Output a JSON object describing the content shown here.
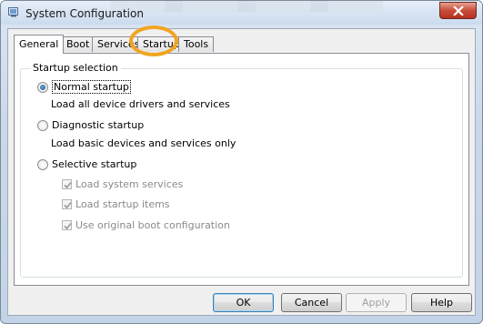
{
  "window": {
    "title": "System Configuration",
    "app_icon": "msconfig-icon",
    "close_icon": "close-icon"
  },
  "tabs": [
    {
      "label": "General",
      "active": true
    },
    {
      "label": "Boot",
      "active": false
    },
    {
      "label": "Services",
      "active": false
    },
    {
      "label": "Startup",
      "active": false
    },
    {
      "label": "Tools",
      "active": false
    }
  ],
  "group": {
    "label": "Startup selection"
  },
  "options": {
    "normal": {
      "label": "Normal startup",
      "description": "Load all device drivers and services",
      "checked": true
    },
    "diagnostic": {
      "label": "Diagnostic startup",
      "description": "Load basic devices and services only",
      "checked": false
    },
    "selective": {
      "label": "Selective startup",
      "checked": false
    }
  },
  "selective_items": [
    {
      "label": "Load system services",
      "checked": true
    },
    {
      "label": "Load startup items",
      "checked": true
    },
    {
      "label": "Use original boot configuration",
      "checked": true
    }
  ],
  "buttons": {
    "ok": "OK",
    "cancel": "Cancel",
    "apply": "Apply",
    "help": "Help"
  },
  "colors": {
    "highlight_ring": "#f0a521",
    "close_button": "#c84d3a"
  }
}
